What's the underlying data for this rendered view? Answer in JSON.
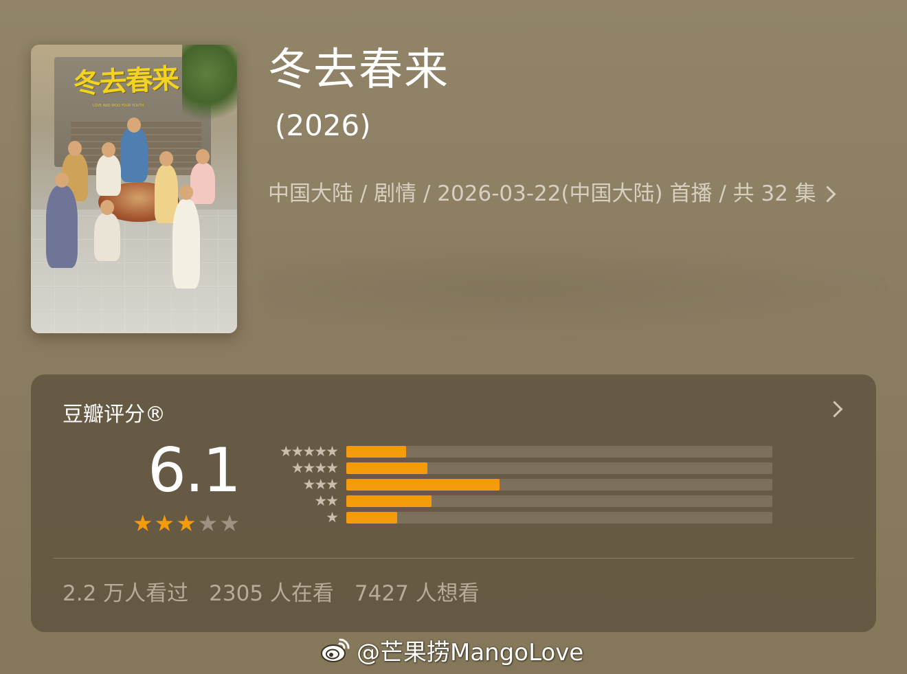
{
  "movie": {
    "title": "冬去春来",
    "year": "(2026)",
    "meta": "中国大陆 / 剧情 / 2026-03-22(中国大陆) 首播 / 共 32 集",
    "poster_logo": "冬去春来",
    "poster_logo_sub": "LOVE AND WOO YOUR YOUTH"
  },
  "rating": {
    "label": "豆瓣评分®",
    "score": "6.1",
    "stars": {
      "filled": 3,
      "total": 5
    },
    "distribution": [
      {
        "stars": "★★★★★",
        "fraction": 0.14
      },
      {
        "stars": "★★★★",
        "fraction": 0.19
      },
      {
        "stars": "★★★",
        "fraction": 0.36
      },
      {
        "stars": "★★",
        "fraction": 0.2
      },
      {
        "stars": "★",
        "fraction": 0.12
      }
    ],
    "counts": {
      "watched": "2.2 万人看过",
      "watching": "2305 人在看",
      "want": "7427 人想看"
    }
  },
  "watermark": {
    "text": "@芒果捞MangoLove",
    "icon": "weibo-icon"
  },
  "colors": {
    "background": "#8e8064",
    "card": "#5a4e3a",
    "accent": "#f59a0b",
    "bar_track": "#7d715c"
  }
}
